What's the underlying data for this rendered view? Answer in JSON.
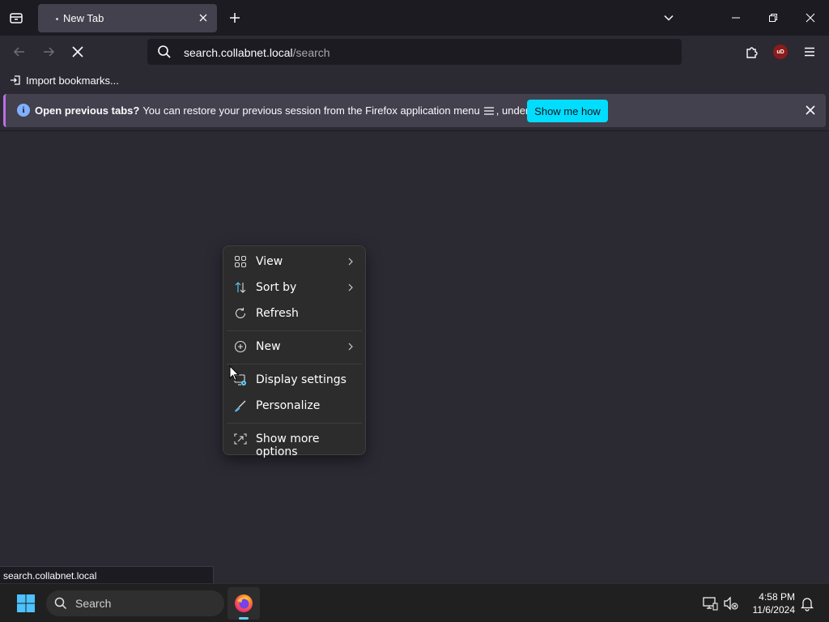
{
  "browser": {
    "tab": {
      "title": "New Tab"
    },
    "url": {
      "host": "search.collabnet.local",
      "path": "/search"
    },
    "extension_badge": "uD",
    "bookmarks": {
      "import_label": "Import bookmarks..."
    },
    "notification": {
      "bold": "Open previous tabs?",
      "text_before": "You can restore your previous session from the Firefox application menu",
      "text_after": ", under History.",
      "button": "Show me how"
    },
    "status_url": "search.collabnet.local"
  },
  "context_menu": {
    "items": [
      {
        "label": "View",
        "icon": "view-grid-icon",
        "submenu": true
      },
      {
        "label": "Sort by",
        "icon": "sort-icon",
        "submenu": true
      },
      {
        "label": "Refresh",
        "icon": "refresh-icon",
        "submenu": false
      },
      {
        "label": "New",
        "icon": "new-plus-icon",
        "submenu": true
      },
      {
        "label": "Display settings",
        "icon": "display-settings-icon",
        "submenu": false
      },
      {
        "label": "Personalize",
        "icon": "personalize-brush-icon",
        "submenu": false
      },
      {
        "label": "Show more options",
        "icon": "show-more-options-icon",
        "submenu": false
      }
    ]
  },
  "taskbar": {
    "search_label": "Search",
    "time": "4:58 PM",
    "date": "11/6/2024"
  },
  "colors": {
    "accent": "#00ddff",
    "toolbar": "#2b2a33",
    "tabstrip": "#1c1b22",
    "menu": "#2c2c2c"
  }
}
